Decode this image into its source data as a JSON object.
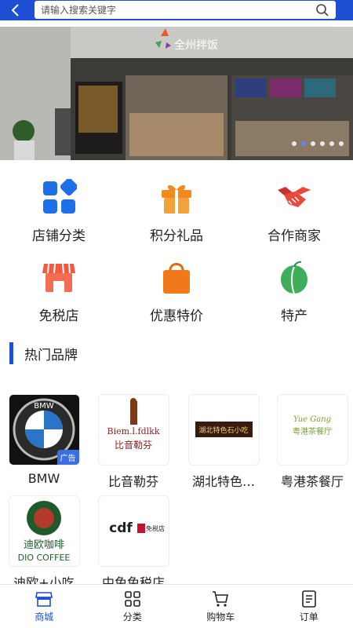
{
  "search": {
    "placeholder": "请输入搜索关键字"
  },
  "banner": {
    "store_sign": "全州拌饭",
    "slides": 6,
    "active_slide": 1
  },
  "features": [
    {
      "label": "店铺分类",
      "icon": "grid-icon",
      "color": "#1f6fe8"
    },
    {
      "label": "积分礼品",
      "icon": "gift-icon",
      "color": "#f08a1d"
    },
    {
      "label": "合作商家",
      "icon": "handshake-icon",
      "color": "#e9483a"
    },
    {
      "label": "免税店",
      "icon": "shop-icon",
      "color": "#f05a40"
    },
    {
      "label": "优惠特价",
      "icon": "bag-icon",
      "color": "#f07a1a"
    },
    {
      "label": "特产",
      "icon": "fruit-icon",
      "color": "#3fae5a"
    }
  ],
  "section": {
    "title": "热门品牌"
  },
  "brands": [
    {
      "name": "BMW",
      "logo_text": "BMW",
      "ad": "广告"
    },
    {
      "name": "比音勒芬",
      "logo_text": "Biem.l.fdlkk",
      "logo_sub": "比音勒芬"
    },
    {
      "name": "湖北特色…",
      "logo_text": "湖北特色石小吃"
    },
    {
      "name": "粤港茶餐厅",
      "logo_text": "Yue Gang",
      "logo_sub": "粤港茶餐厅"
    },
    {
      "name": "迪欧+小吃",
      "logo_text": "迪欧咖啡",
      "logo_sub": "DIO COFFEE"
    },
    {
      "name": "中免免税店",
      "logo_text": "cdf",
      "logo_sub": "免税店"
    }
  ],
  "tabbar": [
    {
      "label": "商城",
      "icon": "store-icon",
      "active": true
    },
    {
      "label": "分类",
      "icon": "category-icon",
      "active": false
    },
    {
      "label": "购物车",
      "icon": "cart-icon",
      "active": false
    },
    {
      "label": "订单",
      "icon": "order-icon",
      "active": false
    }
  ]
}
